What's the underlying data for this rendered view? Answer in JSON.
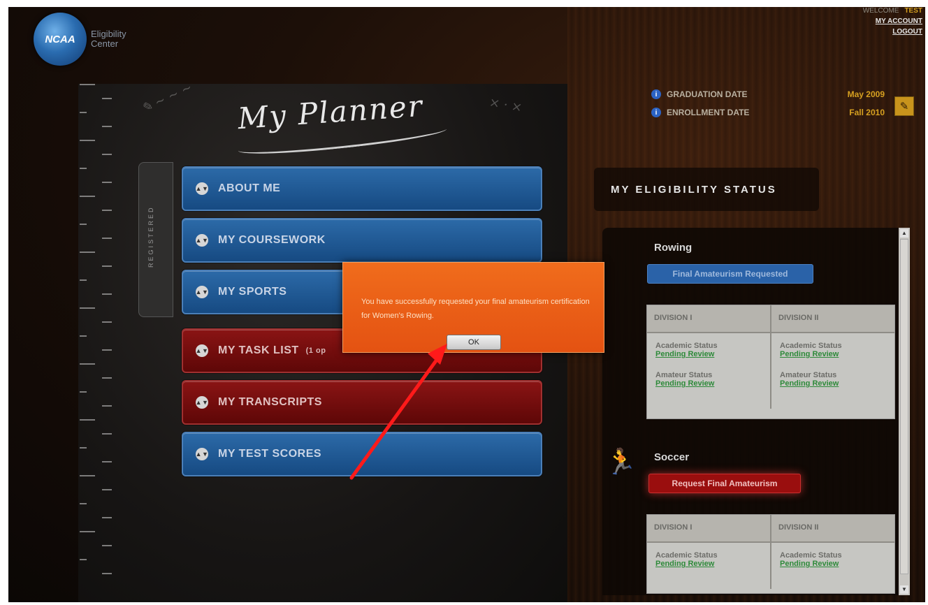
{
  "header": {
    "logo_text": "NCAA",
    "logo_sub_line1": "Eligibility",
    "logo_sub_line2": "Center",
    "welcome_label": "WELCOME",
    "username": "TEST",
    "my_account": "MY ACCOUNT",
    "logout": "LOGOUT"
  },
  "dates": {
    "graduation_label": "GRADUATION DATE",
    "graduation_value": "May 2009",
    "enrollment_label": "ENROLLMENT DATE",
    "enrollment_value": "Fall 2010"
  },
  "planner": {
    "title": "My Planner",
    "registered_tab": "REGISTERED",
    "menu": [
      {
        "label": "ABOUT ME",
        "color": "#1f5a96"
      },
      {
        "label": "MY COURSEWORK",
        "color": "#1f5a96"
      },
      {
        "label": "MY SPORTS",
        "color": "#1f5a96"
      },
      {
        "label": "MY TASK LIST",
        "badge": "(1 op",
        "color": "#7a0c0c"
      },
      {
        "label": "MY TRANSCRIPTS",
        "color": "#7a0c0c"
      },
      {
        "label": "MY TEST SCORES",
        "color": "#1f5a96"
      }
    ]
  },
  "eligibility": {
    "header": "MY ELIGIBILITY STATUS",
    "sports": [
      {
        "name": "Rowing",
        "button": "Final Amateurism Requested",
        "divisions": [
          "DIVISION I",
          "DIVISION II"
        ],
        "academic_label": "Academic Status",
        "academic_value": "Pending Review",
        "amateur_label": "Amateur Status",
        "amateur_value": "Pending Review"
      },
      {
        "name": "Soccer",
        "button": "Request Final Amateurism",
        "divisions": [
          "DIVISION I",
          "DIVISION II"
        ],
        "academic_label": "Academic Status",
        "academic_value": "Pending Review"
      }
    ]
  },
  "modal": {
    "message": "You have successfully requested your final amateurism certification for Women's Rowing.",
    "ok_label": "OK"
  },
  "colors": {
    "modal_orange": "#ec5e16",
    "accent_gold": "#d6a020",
    "status_green": "#2e8a3a"
  },
  "icons": {
    "info": "info-icon",
    "edit": "pencil-icon",
    "updown": "updown-arrow-icon",
    "athlete": "runner-icon"
  }
}
